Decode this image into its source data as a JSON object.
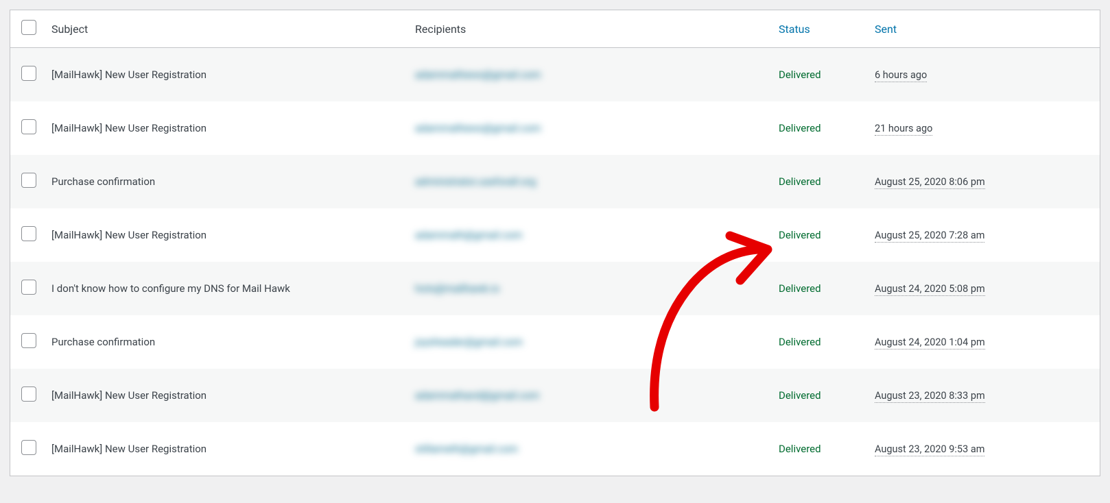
{
  "headers": {
    "subject": "Subject",
    "recipients": "Recipients",
    "status": "Status",
    "sent": "Sent"
  },
  "rows": [
    {
      "subject": "[MailHawk] New User Registration",
      "recipient": "adammathews@gmail.com",
      "status": "Delivered",
      "sent": "6 hours ago"
    },
    {
      "subject": "[MailHawk] New User Registration",
      "recipient": "adammathews@gmail.com",
      "status": "Delivered",
      "sent": "21 hours ago"
    },
    {
      "subject": "Purchase confirmation",
      "recipient": "administrator.useforall.org",
      "status": "Delivered",
      "sent": "August 25, 2020 8:06 pm"
    },
    {
      "subject": "[MailHawk] New User Registration",
      "recipient": "adammath@gmail.com",
      "status": "Delivered",
      "sent": "August 25, 2020 7:28 am"
    },
    {
      "subject": "I don't know how to configure my DNS for Mail Hawk",
      "recipient": "hots@mailhawk.io",
      "status": "Delivered",
      "sent": "August 24, 2020 5:08 pm"
    },
    {
      "subject": "Purchase confirmation",
      "recipient": "joysheader@gmail.com",
      "status": "Delivered",
      "sent": "August 24, 2020 1:04 pm"
    },
    {
      "subject": "[MailHawk] New User Registration",
      "recipient": "adammathand@gmail.com",
      "status": "Delivered",
      "sent": "August 23, 2020 8:33 pm"
    },
    {
      "subject": "[MailHawk] New User Registration",
      "recipient": "stillameth@gmail.com",
      "status": "Delivered",
      "sent": "August 23, 2020 9:53 am"
    }
  ]
}
